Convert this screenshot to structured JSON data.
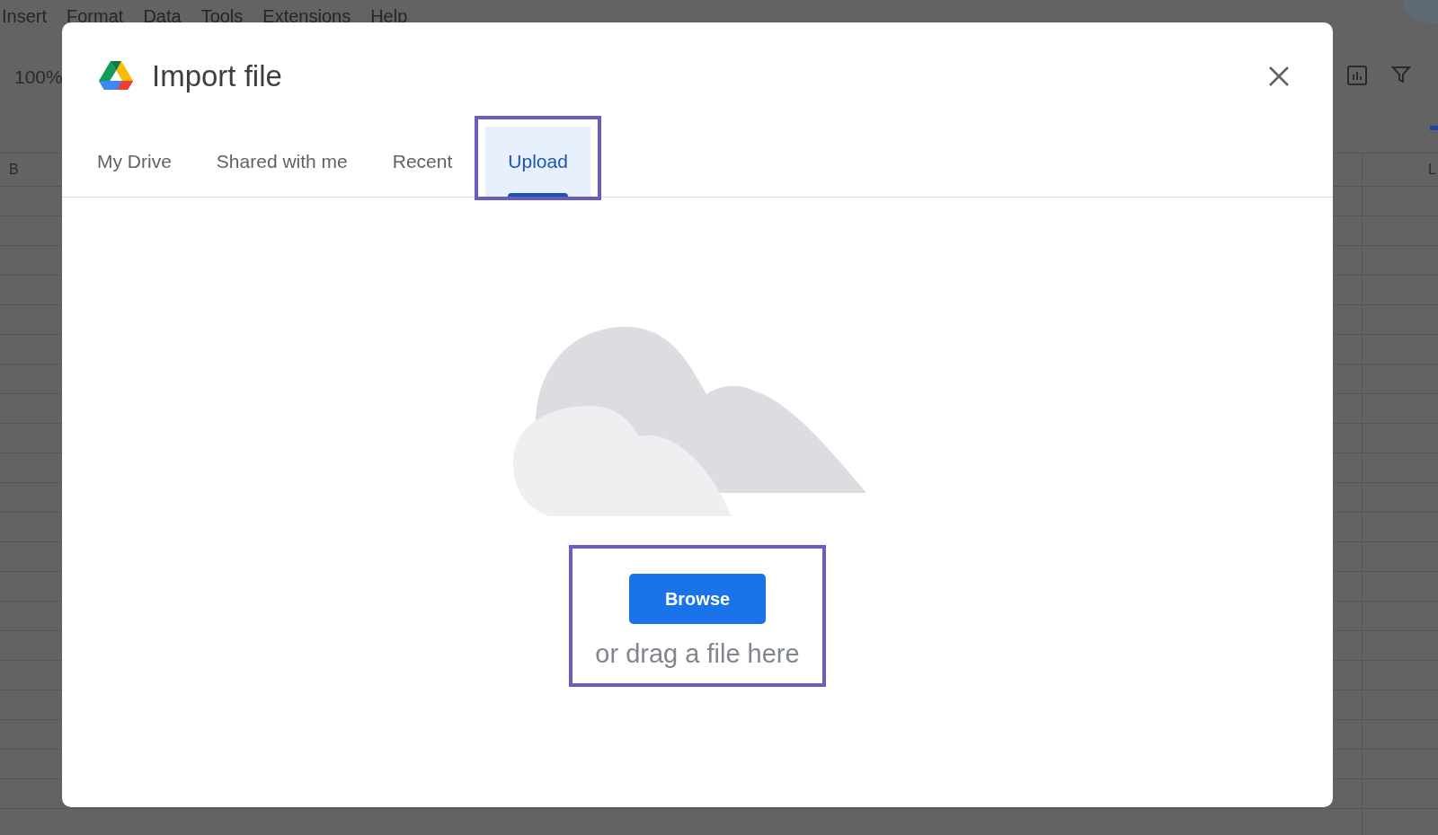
{
  "menu": [
    "Insert",
    "Format",
    "Data",
    "Tools",
    "Extensions",
    "Help"
  ],
  "toolbar": {
    "zoom": "100%"
  },
  "columns": [
    "B",
    "L"
  ],
  "dialog": {
    "title": "Import file",
    "tabs": [
      {
        "label": "My Drive",
        "selected": false,
        "highlighted": false
      },
      {
        "label": "Shared with me",
        "selected": false,
        "highlighted": false
      },
      {
        "label": "Recent",
        "selected": false,
        "highlighted": false
      },
      {
        "label": "Upload",
        "selected": true,
        "highlighted": true
      }
    ],
    "drop_zone": {
      "highlighted": true,
      "button": "Browse",
      "hint": "or drag a file here"
    }
  }
}
